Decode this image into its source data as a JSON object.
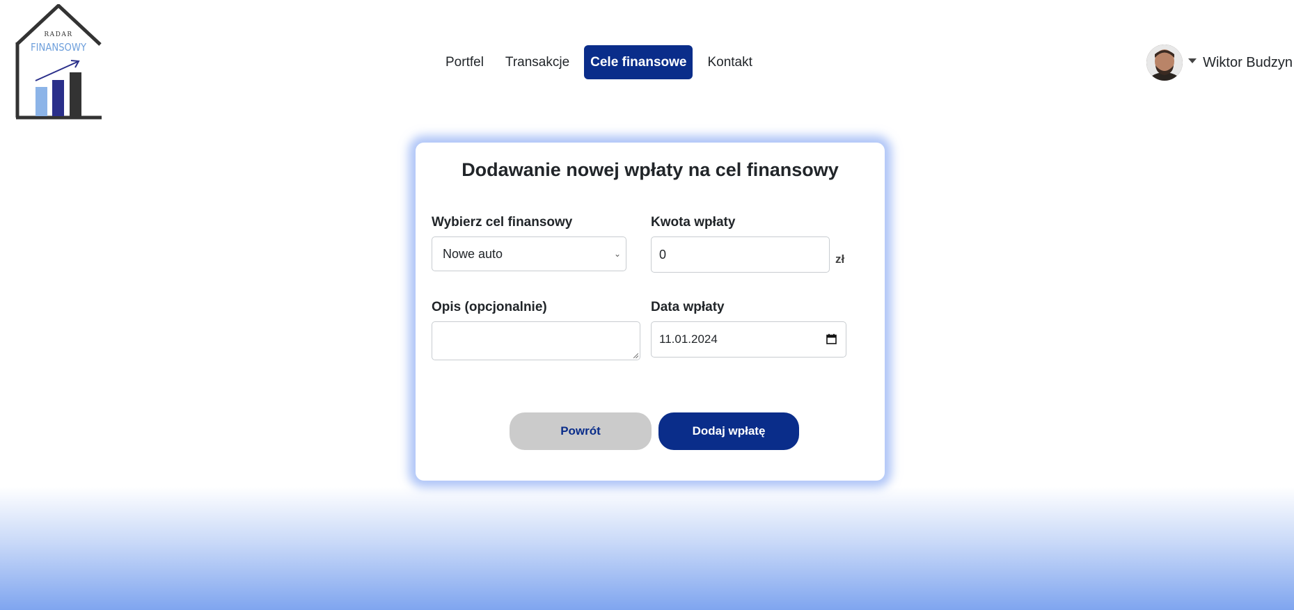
{
  "logo": {
    "top_text": "RADAR",
    "main_text": "FINANSOWY"
  },
  "nav": {
    "items": [
      {
        "label": "Portfel"
      },
      {
        "label": "Transakcje"
      },
      {
        "label": "Cele finansowe",
        "active": true
      },
      {
        "label": "Kontakt"
      }
    ]
  },
  "user": {
    "name": "Wiktor Budzyn"
  },
  "form": {
    "title": "Dodawanie nowej wpłaty na cel finansowy",
    "goal_label": "Wybierz cel finansowy",
    "goal_selected": "Nowe auto",
    "amount_label": "Kwota wpłaty",
    "amount_value": "0",
    "currency": "zł",
    "description_label": "Opis (opcjonalnie)",
    "description_value": "",
    "date_label": "Data wpłaty",
    "date_value": "11.01.2024",
    "back_button": "Powrót",
    "submit_button": "Dodaj wpłatę"
  },
  "colors": {
    "primary": "#0a2d8a",
    "secondary_button": "#cbcbcb",
    "card_glow": "#6e96f0",
    "logo_dark": "#333333",
    "logo_light_blue": "#8cb4e8",
    "logo_navy": "#2a2f8a"
  }
}
